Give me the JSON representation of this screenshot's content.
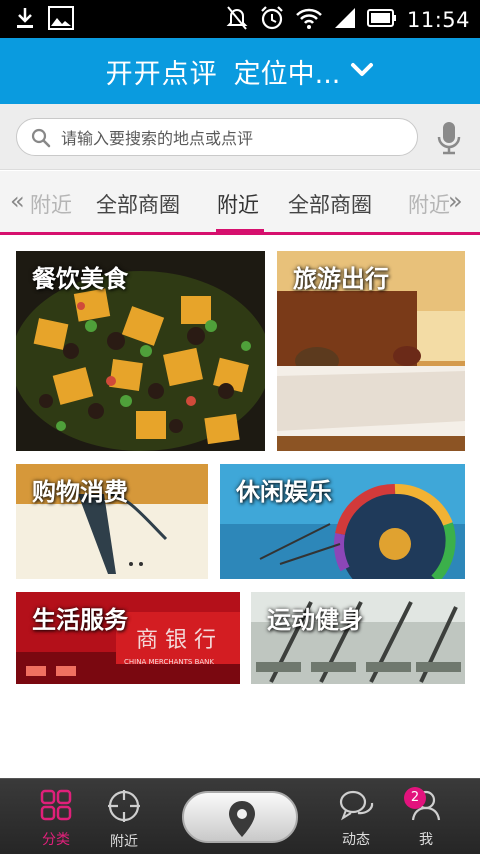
{
  "status_bar": {
    "time": "11:54",
    "icons": [
      "download-icon",
      "image-icon",
      "mute-icon",
      "alarm-icon",
      "wifi-icon",
      "signal-icon",
      "battery-icon"
    ]
  },
  "header": {
    "title": "开开点评",
    "location": "定位中...",
    "dropdown_icon": "chevron-down-icon",
    "background_color": "#0a9bdf"
  },
  "search": {
    "placeholder": "请输入要搜索的地点或点评",
    "value": "",
    "mic_icon": "microphone-icon"
  },
  "tabs": {
    "items": [
      {
        "label": "附近",
        "state": "faded"
      },
      {
        "label": "全部商圈",
        "state": "normal"
      },
      {
        "label": "附近",
        "state": "active"
      },
      {
        "label": "全部商圈",
        "state": "normal"
      },
      {
        "label": "附近",
        "state": "faded"
      }
    ],
    "accent_color": "#d6106e"
  },
  "categories": [
    {
      "label": "餐饮美食"
    },
    {
      "label": "旅游出行"
    },
    {
      "label": "购物消费"
    },
    {
      "label": "休闲娱乐"
    },
    {
      "label": "生活服务"
    },
    {
      "label": "运动健身"
    }
  ],
  "bottom_nav": {
    "items": [
      {
        "label": "分类",
        "icon": "grid-icon",
        "active": true
      },
      {
        "label": "附近",
        "icon": "crosshair-icon",
        "active": false
      },
      {
        "label": "",
        "icon": "location-pin-icon",
        "active": false
      },
      {
        "label": "动态",
        "icon": "chat-bubbles-icon",
        "active": false
      },
      {
        "label": "我",
        "icon": "user-icon",
        "active": false
      }
    ],
    "badge_count": "2",
    "active_color": "#e0207a"
  }
}
